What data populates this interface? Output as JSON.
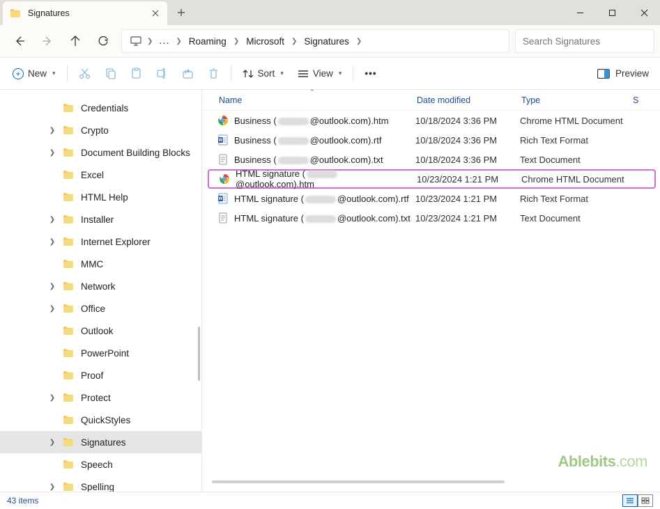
{
  "tab": {
    "title": "Signatures"
  },
  "breadcrumb": [
    "Roaming",
    "Microsoft",
    "Signatures"
  ],
  "search": {
    "placeholder": "Search Signatures"
  },
  "toolbar": {
    "new": "New",
    "sort": "Sort",
    "view": "View",
    "preview": "Preview"
  },
  "tree": [
    {
      "label": "Credentials",
      "arrow": false,
      "selected": false
    },
    {
      "label": "Crypto",
      "arrow": true,
      "selected": false
    },
    {
      "label": "Document Building Blocks",
      "arrow": true,
      "selected": false
    },
    {
      "label": "Excel",
      "arrow": false,
      "selected": false
    },
    {
      "label": "HTML Help",
      "arrow": false,
      "selected": false
    },
    {
      "label": "Installer",
      "arrow": true,
      "selected": false
    },
    {
      "label": "Internet Explorer",
      "arrow": true,
      "selected": false
    },
    {
      "label": "MMC",
      "arrow": false,
      "selected": false
    },
    {
      "label": "Network",
      "arrow": true,
      "selected": false
    },
    {
      "label": "Office",
      "arrow": true,
      "selected": false
    },
    {
      "label": "Outlook",
      "arrow": false,
      "selected": false
    },
    {
      "label": "PowerPoint",
      "arrow": false,
      "selected": false
    },
    {
      "label": "Proof",
      "arrow": false,
      "selected": false
    },
    {
      "label": "Protect",
      "arrow": true,
      "selected": false
    },
    {
      "label": "QuickStyles",
      "arrow": false,
      "selected": false
    },
    {
      "label": "Signatures",
      "arrow": true,
      "selected": true
    },
    {
      "label": "Speech",
      "arrow": false,
      "selected": false
    },
    {
      "label": "Spelling",
      "arrow": true,
      "selected": false
    }
  ],
  "columns": {
    "name": "Name",
    "date": "Date modified",
    "type": "Type",
    "size": "S"
  },
  "files": [
    {
      "icon": "chrome",
      "prefix": "Business (",
      "suffix": "@outlook.com).htm",
      "date": "10/18/2024 3:36 PM",
      "type": "Chrome HTML Document",
      "highlighted": false
    },
    {
      "icon": "rtf",
      "prefix": "Business (",
      "suffix": "@outlook.com).rtf",
      "date": "10/18/2024 3:36 PM",
      "type": "Rich Text Format",
      "highlighted": false
    },
    {
      "icon": "txt",
      "prefix": "Business (",
      "suffix": "@outlook.com).txt",
      "date": "10/18/2024 3:36 PM",
      "type": "Text Document",
      "highlighted": false
    },
    {
      "icon": "chrome",
      "prefix": "HTML signature (",
      "suffix": "@outlook.com).htm",
      "date": "10/23/2024 1:21 PM",
      "type": "Chrome HTML Document",
      "highlighted": true
    },
    {
      "icon": "rtf",
      "prefix": "HTML signature (",
      "suffix": "@outlook.com).rtf",
      "date": "10/23/2024 1:21 PM",
      "type": "Rich Text Format",
      "highlighted": false
    },
    {
      "icon": "txt",
      "prefix": "HTML signature (",
      "suffix": "@outlook.com).txt",
      "date": "10/23/2024 1:21 PM",
      "type": "Text Document",
      "highlighted": false
    }
  ],
  "status": {
    "items": "43 items"
  },
  "watermark": {
    "brand": "Ablebits",
    "suffix": ".com"
  }
}
